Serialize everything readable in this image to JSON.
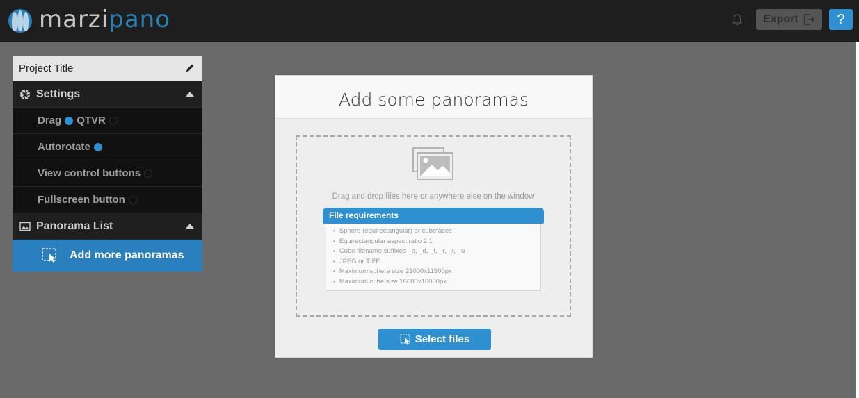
{
  "app": {
    "logo_part1": "marzi",
    "logo_part2": "pano",
    "colors": {
      "topbar": "#1e1e1e",
      "accent": "#2e8fd1",
      "stage": "#6a6a6a"
    }
  },
  "toolbar": {
    "export_label": "Export",
    "help_label": "?",
    "icons": [
      "bell-icon",
      "export-icon",
      "help-icon"
    ]
  },
  "sidebar": {
    "project_title": "Project Title",
    "settings_label": "Settings",
    "settings_items": [
      {
        "label": "Drag",
        "state": "on"
      },
      {
        "label": "QTVR",
        "state": "off"
      },
      {
        "label": "Autorotate",
        "state": "on"
      },
      {
        "label": "View control buttons",
        "state": "off"
      },
      {
        "label": "Fullscreen button",
        "state": "off"
      }
    ],
    "panorama_list_label": "Panorama List",
    "add_more_label": "Add more panoramas"
  },
  "modal": {
    "title": "Add some panoramas",
    "drop_text": "Drag and drop files here or anywhere else on the window",
    "requirements_title": "File requirements",
    "requirements": [
      "Sphere (equirectangular) or cubefaces",
      "Equirectangular aspect ratio 2:1",
      "Cube filename suffixes _b, _d, _f, _r, _t, _u",
      "JPEG or TIFF",
      "Maximum sphere size 23000x11500px",
      "Maximum cube size 16000x16000px"
    ],
    "select_files_label": "Select files"
  }
}
